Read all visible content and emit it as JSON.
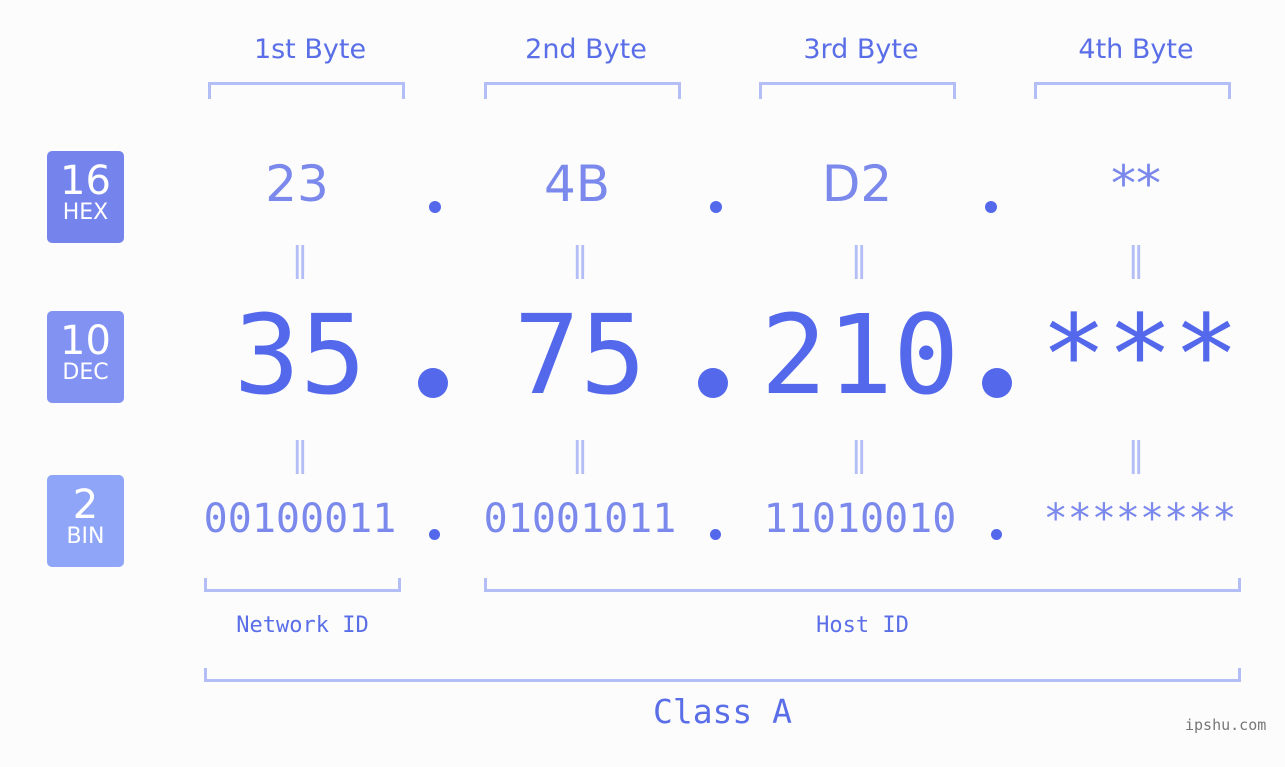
{
  "bytes": [
    {
      "header": "1st Byte",
      "hex": "23",
      "dec": "35",
      "bin": "00100011"
    },
    {
      "header": "2nd Byte",
      "hex": "4B",
      "dec": "75",
      "bin": "01001011"
    },
    {
      "header": "3rd Byte",
      "hex": "D2",
      "dec": "210",
      "bin": "11010010"
    },
    {
      "header": "4th Byte",
      "hex": "**",
      "dec": "***",
      "bin": "********"
    }
  ],
  "badges": {
    "hex": {
      "num": "16",
      "label": "HEX",
      "color": "#7583ec"
    },
    "dec": {
      "num": "10",
      "label": "DEC",
      "color": "#8292f2"
    },
    "bin": {
      "num": "2",
      "label": "BIN",
      "color": "#8fa5f8"
    }
  },
  "equals": "=",
  "labels": {
    "network": "Network ID",
    "host": "Host ID",
    "class": "Class A"
  },
  "watermark": "ipshu.com"
}
